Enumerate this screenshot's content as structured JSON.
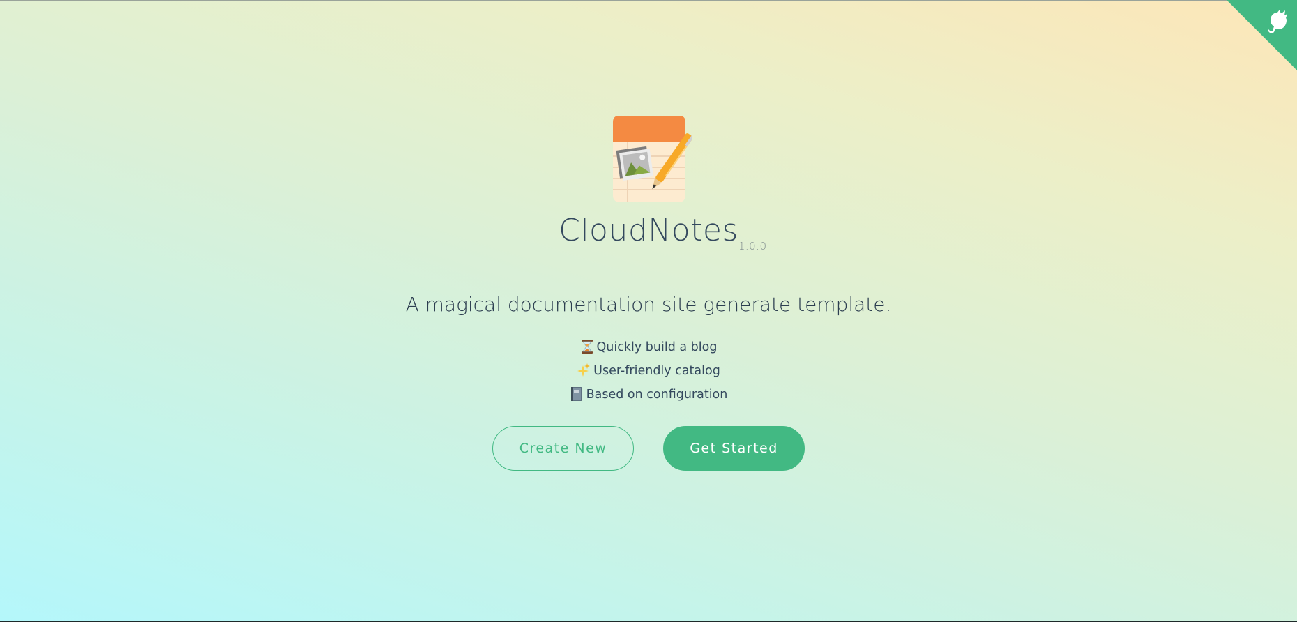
{
  "app": {
    "title": "CloudNotes",
    "version": "1.0.0",
    "tagline": "A magical documentation site generate template."
  },
  "features": [
    {
      "icon": "hourglass-icon",
      "text": "Quickly build a blog"
    },
    {
      "icon": "sparkles-icon",
      "text": "User-friendly catalog"
    },
    {
      "icon": "notebook-icon",
      "text": "Based on configuration"
    }
  ],
  "buttons": {
    "create_label": "Create New",
    "start_label": "Get Started"
  },
  "corner": {
    "icon": "github-octocat-icon"
  },
  "colors": {
    "accent": "#42b983",
    "text": "#34495e",
    "logo_header": "#f48a42",
    "logo_paper": "#fdebd0"
  }
}
